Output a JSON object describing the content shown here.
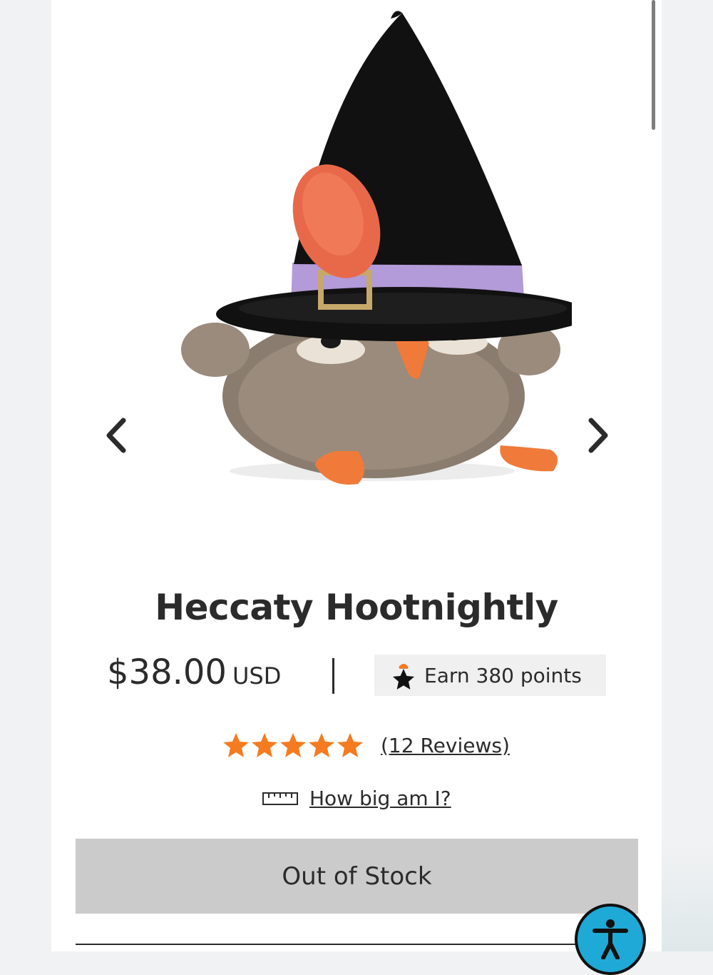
{
  "carousel": {
    "prev_icon": "chevron-left-icon",
    "next_icon": "chevron-right-icon",
    "image_alt": "Heccaty Hootnightly"
  },
  "product": {
    "title": "Heccaty Hootnightly",
    "price": "$38.00",
    "currency": "USD",
    "points_label": "Earn 380 points",
    "rating": 5,
    "reviews_label": "(12 Reviews)",
    "size_guide_label": "How big am I?",
    "stock_label": "Out of Stock"
  },
  "colors": {
    "star": "#f47b20",
    "stock_button": "#cbcbcb",
    "a11y": "#1fa9d6"
  },
  "icons": {
    "points": "star-icon",
    "size": "ruler-icon",
    "accessibility": "accessibility-icon"
  }
}
